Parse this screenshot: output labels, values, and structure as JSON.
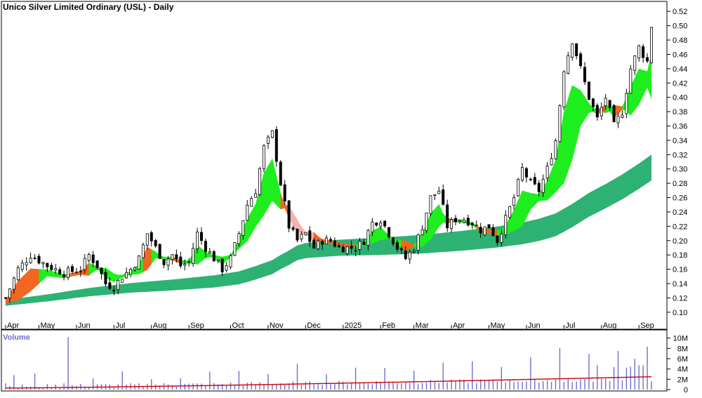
{
  "title": "Unico Silver Limited Ordinary (USL) - Daily",
  "volume_label": "Volume",
  "colors": {
    "background": "#ffffff",
    "candle": "#000000",
    "short_ribbon_up": "#1eee1e",
    "short_ribbon_down": "#f26522",
    "short_ribbon_faded": "#f4b3b3",
    "long_ribbon": "#2eb273",
    "volume_bar": "#6f6fcf",
    "volume_avg": "#cc0000",
    "axis": "#000000",
    "grid": "#d8d8d8"
  },
  "chart_data": [
    {
      "type": "candlestick",
      "title": "Unico Silver Limited Ordinary (USL) - Daily",
      "x_tick_labels": [
        "Apr",
        "May",
        "Jun",
        "Jul",
        "Aug",
        "Sep",
        "Oct",
        "Nov",
        "Dec",
        "2025",
        "Feb",
        "Mar",
        "Apr",
        "May",
        "Jun",
        "Jul",
        "Aug",
        "Sep"
      ],
      "y_tick_labels": [
        "0.10",
        "0.12",
        "0.14",
        "0.16",
        "0.18",
        "0.20",
        "0.22",
        "0.24",
        "0.26",
        "0.28",
        "0.30",
        "0.32",
        "0.34",
        "0.36",
        "0.38",
        "0.40",
        "0.42",
        "0.44",
        "0.46",
        "0.48",
        "0.50",
        "0.52"
      ],
      "ylim": [
        0.09,
        0.53
      ],
      "grid": false,
      "price_path": [
        [
          0,
          0.12
        ],
        [
          3,
          0.16
        ],
        [
          6,
          0.18
        ],
        [
          10,
          0.165
        ],
        [
          14,
          0.155
        ],
        [
          18,
          0.16
        ],
        [
          20,
          0.18
        ],
        [
          22,
          0.165
        ],
        [
          24,
          0.14
        ],
        [
          26,
          0.135
        ],
        [
          28,
          0.15
        ],
        [
          30,
          0.16
        ],
        [
          32,
          0.175
        ],
        [
          34,
          0.21
        ],
        [
          36,
          0.19
        ],
        [
          38,
          0.17
        ],
        [
          40,
          0.18
        ],
        [
          42,
          0.165
        ],
        [
          44,
          0.17
        ],
        [
          46,
          0.21
        ],
        [
          48,
          0.19
        ],
        [
          50,
          0.175
        ],
        [
          52,
          0.16
        ],
        [
          54,
          0.175
        ],
        [
          56,
          0.21
        ],
        [
          58,
          0.25
        ],
        [
          60,
          0.27
        ],
        [
          62,
          0.33
        ],
        [
          64,
          0.35
        ],
        [
          66,
          0.28
        ],
        [
          68,
          0.22
        ],
        [
          70,
          0.2
        ],
        [
          72,
          0.21
        ],
        [
          74,
          0.19
        ],
        [
          76,
          0.2
        ],
        [
          78,
          0.2
        ],
        [
          80,
          0.19
        ],
        [
          82,
          0.19
        ],
        [
          84,
          0.19
        ],
        [
          86,
          0.2
        ],
        [
          88,
          0.225
        ],
        [
          90,
          0.23
        ],
        [
          92,
          0.21
        ],
        [
          94,
          0.19
        ],
        [
          96,
          0.175
        ],
        [
          98,
          0.19
        ],
        [
          100,
          0.22
        ],
        [
          102,
          0.26
        ],
        [
          104,
          0.27
        ],
        [
          106,
          0.22
        ],
        [
          108,
          0.23
        ],
        [
          110,
          0.23
        ],
        [
          112,
          0.225
        ],
        [
          114,
          0.215
        ],
        [
          116,
          0.22
        ],
        [
          118,
          0.2
        ],
        [
          120,
          0.23
        ],
        [
          122,
          0.26
        ],
        [
          124,
          0.3
        ],
        [
          126,
          0.28
        ],
        [
          128,
          0.27
        ],
        [
          130,
          0.3
        ],
        [
          132,
          0.34
        ],
        [
          134,
          0.44
        ],
        [
          136,
          0.48
        ],
        [
          138,
          0.44
        ],
        [
          140,
          0.4
        ],
        [
          142,
          0.37
        ],
        [
          144,
          0.4
        ],
        [
          146,
          0.36
        ],
        [
          148,
          0.38
        ],
        [
          150,
          0.44
        ],
        [
          152,
          0.47
        ],
        [
          154,
          0.45
        ],
        [
          155,
          0.5
        ]
      ],
      "short_ribbon_path": [
        [
          0,
          0.115
        ],
        [
          6,
          0.145
        ],
        [
          10,
          0.155
        ],
        [
          14,
          0.15
        ],
        [
          18,
          0.155
        ],
        [
          20,
          0.16
        ],
        [
          22,
          0.162
        ],
        [
          24,
          0.155
        ],
        [
          26,
          0.148
        ],
        [
          28,
          0.15
        ],
        [
          30,
          0.155
        ],
        [
          32,
          0.16
        ],
        [
          34,
          0.175
        ],
        [
          36,
          0.18
        ],
        [
          38,
          0.175
        ],
        [
          40,
          0.175
        ],
        [
          42,
          0.17
        ],
        [
          44,
          0.17
        ],
        [
          46,
          0.18
        ],
        [
          48,
          0.18
        ],
        [
          50,
          0.178
        ],
        [
          52,
          0.172
        ],
        [
          54,
          0.178
        ],
        [
          56,
          0.195
        ],
        [
          58,
          0.215
        ],
        [
          60,
          0.235
        ],
        [
          62,
          0.265
        ],
        [
          64,
          0.285
        ],
        [
          66,
          0.255
        ],
        [
          68,
          0.24
        ],
        [
          70,
          0.22
        ],
        [
          72,
          0.21
        ],
        [
          74,
          0.205
        ],
        [
          76,
          0.2
        ],
        [
          78,
          0.198
        ],
        [
          80,
          0.195
        ],
        [
          82,
          0.193
        ],
        [
          84,
          0.192
        ],
        [
          86,
          0.195
        ],
        [
          88,
          0.205
        ],
        [
          90,
          0.21
        ],
        [
          92,
          0.205
        ],
        [
          94,
          0.198
        ],
        [
          96,
          0.192
        ],
        [
          98,
          0.193
        ],
        [
          100,
          0.2
        ],
        [
          102,
          0.22
        ],
        [
          104,
          0.235
        ],
        [
          106,
          0.228
        ],
        [
          108,
          0.228
        ],
        [
          110,
          0.227
        ],
        [
          112,
          0.223
        ],
        [
          114,
          0.215
        ],
        [
          116,
          0.213
        ],
        [
          118,
          0.21
        ],
        [
          120,
          0.215
        ],
        [
          122,
          0.228
        ],
        [
          124,
          0.245
        ],
        [
          126,
          0.255
        ],
        [
          128,
          0.26
        ],
        [
          130,
          0.27
        ],
        [
          132,
          0.29
        ],
        [
          134,
          0.33
        ],
        [
          136,
          0.365
        ],
        [
          138,
          0.385
        ],
        [
          140,
          0.385
        ],
        [
          142,
          0.38
        ],
        [
          144,
          0.385
        ],
        [
          146,
          0.38
        ],
        [
          148,
          0.385
        ],
        [
          150,
          0.395
        ],
        [
          152,
          0.415
        ],
        [
          154,
          0.425
        ],
        [
          155,
          0.43
        ]
      ],
      "long_ribbon_path": [
        [
          0,
          0.113
        ],
        [
          10,
          0.12
        ],
        [
          20,
          0.128
        ],
        [
          30,
          0.134
        ],
        [
          40,
          0.138
        ],
        [
          50,
          0.143
        ],
        [
          56,
          0.148
        ],
        [
          60,
          0.155
        ],
        [
          64,
          0.163
        ],
        [
          66,
          0.17
        ],
        [
          68,
          0.176
        ],
        [
          70,
          0.183
        ],
        [
          72,
          0.186
        ],
        [
          80,
          0.19
        ],
        [
          90,
          0.192
        ],
        [
          100,
          0.195
        ],
        [
          110,
          0.2
        ],
        [
          118,
          0.205
        ],
        [
          124,
          0.21
        ],
        [
          128,
          0.215
        ],
        [
          132,
          0.222
        ],
        [
          136,
          0.235
        ],
        [
          140,
          0.25
        ],
        [
          144,
          0.262
        ],
        [
          148,
          0.275
        ],
        [
          152,
          0.29
        ],
        [
          155,
          0.302
        ]
      ],
      "short_ribbon_down_segments": [
        [
          0,
          8
        ],
        [
          15,
          20
        ],
        [
          33,
          35
        ],
        [
          40,
          42
        ],
        [
          66,
          68
        ],
        [
          74,
          84
        ],
        [
          95,
          98
        ],
        [
          106,
          108
        ],
        [
          113,
          118
        ],
        [
          142,
          144
        ],
        [
          146,
          148
        ]
      ],
      "short_ribbon_faded_segments": [
        [
          68,
          74
        ]
      ]
    },
    {
      "type": "bar",
      "title": "Volume",
      "y_tick_labels": [
        "0",
        "2M",
        "4M",
        "6M",
        "8M",
        "10M"
      ],
      "ylim": [
        0,
        10500000
      ],
      "series": [
        {
          "name": "Volume",
          "approx_base": 200000,
          "spike_every_n_days": 7
        },
        {
          "name": "Volume average",
          "start": 300000,
          "end": 2500000
        }
      ]
    }
  ]
}
